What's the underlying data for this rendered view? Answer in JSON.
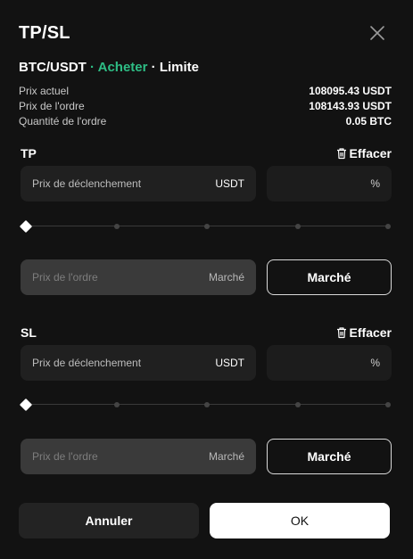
{
  "modal": {
    "title": "TP/SL"
  },
  "order": {
    "pair": "BTC/USDT",
    "separator": "·",
    "side": "Acheter",
    "type": "Limite"
  },
  "info": [
    {
      "label": "Prix actuel",
      "value": "108095.43 USDT"
    },
    {
      "label": "Prix de l'ordre",
      "value": "108143.93 USDT"
    },
    {
      "label": "Quantité de l'ordre",
      "value": "0.05 BTC"
    }
  ],
  "tp": {
    "label": "TP",
    "clear_label": "Effacer",
    "trigger_placeholder": "Prix de déclenchement",
    "trigger_unit": "USDT",
    "percent_unit": "%",
    "slider_value_percent": 0,
    "order_price_placeholder": "Prix de l'ordre",
    "order_price_unit": "Marché",
    "market_button": "Marché"
  },
  "sl": {
    "label": "SL",
    "clear_label": "Effacer",
    "trigger_placeholder": "Prix de déclenchement",
    "trigger_unit": "USDT",
    "percent_unit": "%",
    "slider_value_percent": 0,
    "order_price_placeholder": "Prix de l'ordre",
    "order_price_unit": "Marché",
    "market_button": "Marché"
  },
  "footer": {
    "cancel_label": "Annuler",
    "ok_label": "OK"
  },
  "colors": {
    "background": "#121212",
    "buy_accent": "#2ebd85",
    "field_bg": "#202020",
    "disabled_field_bg": "#3a3a3a",
    "ok_bg": "#ffffff"
  },
  "icons": {
    "close": "close-icon",
    "clear": "trash-icon",
    "slider_thumb": "diamond-icon"
  }
}
